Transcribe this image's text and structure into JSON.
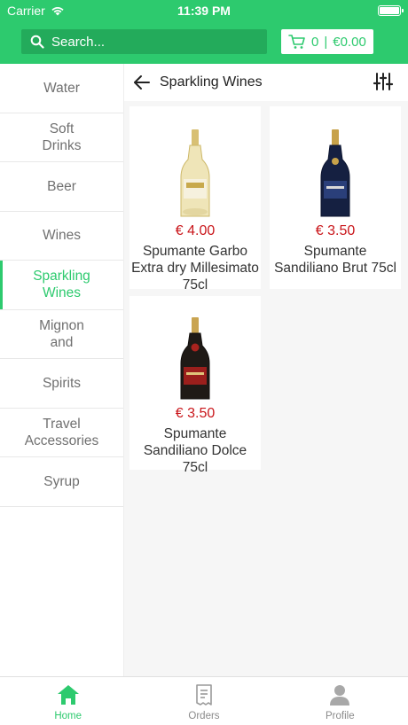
{
  "status": {
    "carrier": "Carrier",
    "time": "11:39 PM"
  },
  "search": {
    "placeholder": "Search..."
  },
  "cart": {
    "count": "0",
    "separator": "|",
    "total": "€0.00"
  },
  "categories": [
    {
      "label": "Water"
    },
    {
      "label": "Soft Drinks"
    },
    {
      "label": "Beer"
    },
    {
      "label": "Wines"
    },
    {
      "label": "Sparkling Wines",
      "active": true
    },
    {
      "label": "Mignon and"
    },
    {
      "label": "Spirits"
    },
    {
      "label": "Travel Accessories"
    },
    {
      "label": "Syrup"
    }
  ],
  "page": {
    "title": "Sparkling Wines"
  },
  "products": [
    {
      "price": "€ 4.00",
      "name": "Spumante Garbo Extra dry Millesimato 75cl",
      "bottle": "gold"
    },
    {
      "price": "€ 3.50",
      "name": "Spumante Sandiliano Brut 75cl",
      "bottle": "dark-blue"
    },
    {
      "price": "€ 3.50",
      "name": "Spumante Sandiliano Dolce 75cl",
      "bottle": "dark-red"
    }
  ],
  "nav": [
    {
      "label": "Home",
      "icon": "home-icon",
      "active": true
    },
    {
      "label": "Orders",
      "icon": "receipt-icon"
    },
    {
      "label": "Profile",
      "icon": "person-icon"
    }
  ],
  "colors": {
    "brand": "#2dca6e",
    "price": "#c9151a"
  }
}
